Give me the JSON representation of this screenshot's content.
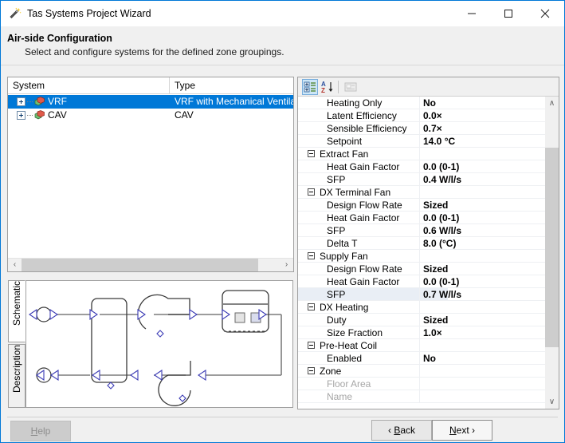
{
  "window": {
    "title": "Tas Systems Project Wizard",
    "icon": "magic-wand-icon",
    "minimize_label": "–",
    "maximize_label": "□",
    "close_label": "✕"
  },
  "header": {
    "title": "Air-side Configuration",
    "subtitle": "Select and configure systems for the defined zone groupings."
  },
  "system_list": {
    "columns": [
      "System",
      "Type"
    ],
    "rows": [
      {
        "name": "VRF",
        "type": "VRF with Mechanical Ventilation",
        "selected": true,
        "expander": "+"
      },
      {
        "name": "CAV",
        "type": "CAV",
        "selected": false,
        "expander": "+"
      }
    ],
    "hscroll": {
      "left_arrow": "‹",
      "right_arrow": "›"
    }
  },
  "schematic": {
    "tabs": [
      {
        "label": "Schematic",
        "active": true
      },
      {
        "label": "Description",
        "active": false
      }
    ]
  },
  "property_grid": {
    "toolbar": [
      {
        "name": "categorized-view-button",
        "active": true
      },
      {
        "name": "alphabetical-sort-button",
        "active": false
      },
      {
        "name": "property-pages-button",
        "active": false,
        "disabled": true
      }
    ],
    "scroll": {
      "up_arrow": "∧",
      "down_arrow": "∨"
    },
    "rows": [
      {
        "kind": "item",
        "label": "Heating Only",
        "value": "No"
      },
      {
        "kind": "item",
        "label": "Latent Efficiency",
        "value": "0.0×"
      },
      {
        "kind": "item",
        "label": "Sensible Efficiency",
        "value": "0.7×"
      },
      {
        "kind": "item",
        "label": "Setpoint",
        "value": "14.0 °C"
      },
      {
        "kind": "category",
        "label": "Extract Fan",
        "value": ""
      },
      {
        "kind": "item",
        "label": "Heat Gain Factor",
        "value": "0.0 (0-1)"
      },
      {
        "kind": "item",
        "label": "SFP",
        "value": "0.4 W/l/s"
      },
      {
        "kind": "category",
        "label": "DX Terminal Fan",
        "value": ""
      },
      {
        "kind": "item",
        "label": "Design Flow Rate",
        "value": "Sized"
      },
      {
        "kind": "item",
        "label": "Heat Gain Factor",
        "value": "0.0 (0-1)"
      },
      {
        "kind": "item",
        "label": "SFP",
        "value": "0.6 W/l/s"
      },
      {
        "kind": "item",
        "label": "Delta T",
        "value": "8.0 (°C)"
      },
      {
        "kind": "category",
        "label": "Supply Fan",
        "value": ""
      },
      {
        "kind": "item",
        "label": "Design Flow Rate",
        "value": "Sized"
      },
      {
        "kind": "item",
        "label": "Heat Gain Factor",
        "value": "0.0 (0-1)"
      },
      {
        "kind": "item",
        "label": "SFP",
        "value": "0.7 W/l/s",
        "selected": true
      },
      {
        "kind": "category",
        "label": "DX Heating",
        "value": ""
      },
      {
        "kind": "item",
        "label": "Duty",
        "value": "Sized"
      },
      {
        "kind": "item",
        "label": "Size Fraction",
        "value": "1.0×"
      },
      {
        "kind": "category",
        "label": "Pre-Heat Coil",
        "value": ""
      },
      {
        "kind": "item",
        "label": "Enabled",
        "value": "No"
      },
      {
        "kind": "category",
        "label": "Zone",
        "value": ""
      },
      {
        "kind": "item",
        "label": "Floor Area",
        "value": "",
        "disabled": true
      },
      {
        "kind": "item",
        "label": "Name",
        "value": "",
        "disabled": true
      }
    ]
  },
  "footer": {
    "help": {
      "label": "Help",
      "mnemonic": "H",
      "disabled": true
    },
    "back": {
      "prefix": "‹ ",
      "label": "Back",
      "mnemonic": "B"
    },
    "next": {
      "label": "Next",
      "suffix": " ›",
      "mnemonic": "N"
    }
  }
}
